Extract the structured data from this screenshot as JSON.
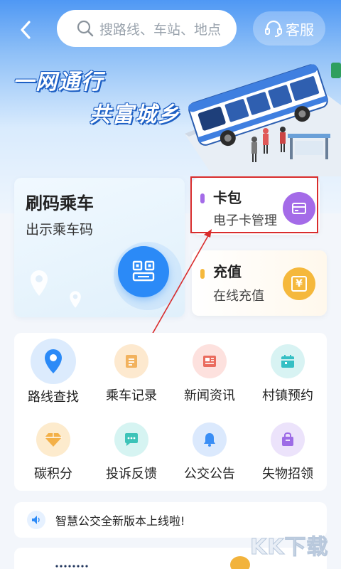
{
  "header": {
    "search_placeholder": "搜路线、车站、地点",
    "service_label": "客服"
  },
  "banner": {
    "slogan_line1": "一网通行",
    "slogan_line2": "共富城乡"
  },
  "cards": {
    "scan": {
      "title": "刷码乘车",
      "subtitle": "出示乘车码"
    },
    "wallet": {
      "title": "卡包",
      "subtitle": "电子卡管理"
    },
    "recharge": {
      "title": "充值",
      "subtitle": "在线充值",
      "icon_glyph": "¥"
    }
  },
  "grid": [
    {
      "label": "路线查找",
      "icon": "location-pin-icon"
    },
    {
      "label": "乘车记录",
      "icon": "document-icon"
    },
    {
      "label": "新闻资讯",
      "icon": "newspaper-icon"
    },
    {
      "label": "村镇预约",
      "icon": "calendar-icon"
    },
    {
      "label": "碳积分",
      "icon": "diamond-icon"
    },
    {
      "label": "投诉反馈",
      "icon": "chat-bubble-icon"
    },
    {
      "label": "公交公告",
      "icon": "bell-icon"
    },
    {
      "label": "失物招领",
      "icon": "bag-icon"
    }
  ],
  "notice": {
    "text": "智慧公交全新版本上线啦!"
  },
  "watermark": "KK下载",
  "colors": {
    "primary": "#2b8af7",
    "wallet_accent": "#a46be8",
    "recharge_accent": "#f5b83c",
    "annotation_red": "#d92c2c"
  }
}
